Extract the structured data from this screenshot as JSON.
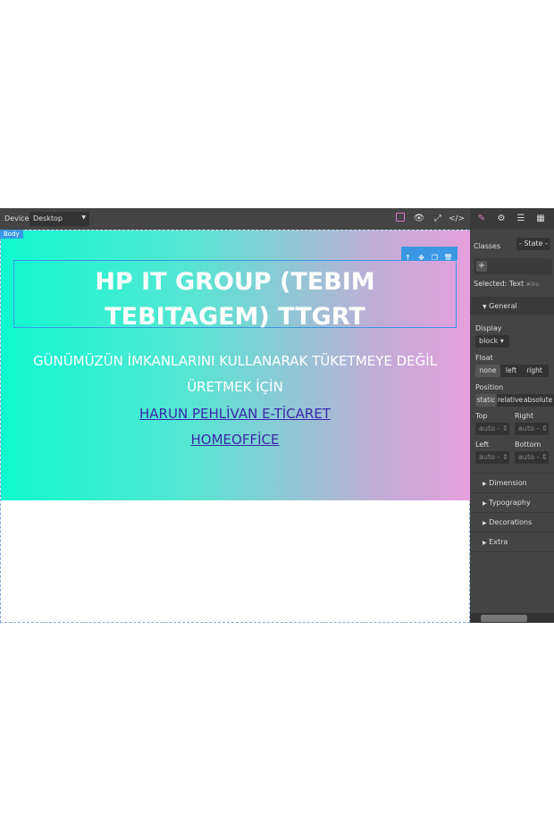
{
  "topbar": {
    "device_label": "Device",
    "device_value": "Desktop",
    "icons": [
      "sw-visibility-icon",
      "preview-eye-icon",
      "fullscreen-icon",
      "code-icon",
      "style-manager-brush-icon",
      "settings-gear-icon",
      "layer-manager-icon",
      "blocks-grid-icon"
    ]
  },
  "canvas": {
    "body_badge": "Body",
    "title": "HP IT GROUP (TEBIM TEBITAGEM) TTGRT",
    "subtitle": "GÜNÜMÜZÜN İMKANLARINI KULLANARAK TÜKETMEYE DEĞİL ÜRETMEK İÇİN",
    "link1": "HARUN PEHLİVAN E-TİCARET",
    "link2": "HOMEOFFİCE",
    "toolbar_icons": [
      "arrow-up-icon",
      "move-icon",
      "copy-icon",
      "delete-icon"
    ],
    "colors": {
      "gradient_start": "#0ff9cf",
      "gradient_end": "#e59fdd",
      "selection": "#3b97e3",
      "link": "#3b2aa8"
    }
  },
  "panel": {
    "classes_label": "Classes",
    "state_value": "- State -",
    "selected_label": "Selected:",
    "selected_value": "Text",
    "selected_id": "#ilro",
    "general": "General",
    "display_label": "Display",
    "display_value": "block",
    "float_label": "Float",
    "float_options": [
      "none",
      "left",
      "right"
    ],
    "position_label": "Position",
    "position_options": [
      "static",
      "relative",
      "absolute"
    ],
    "top_label": "Top",
    "right_label": "Right",
    "left_label": "Left",
    "bottom_label": "Bottom",
    "auto": "auto",
    "sections": [
      "Dimension",
      "Typography",
      "Decorations",
      "Extra"
    ]
  }
}
